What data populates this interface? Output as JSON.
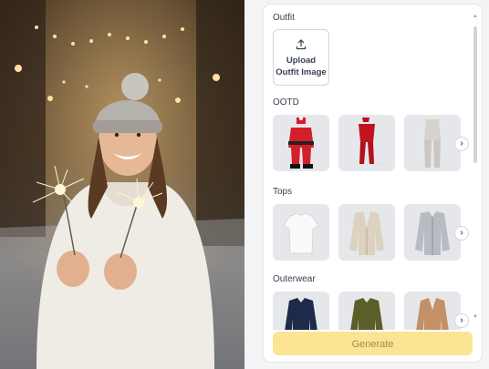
{
  "photo": {
    "icon": "woman-with-sparklers-photo"
  },
  "panel": {
    "outfit": {
      "title": "Outfit",
      "upload_line1": "Upload",
      "upload_line2": "Outfit Image",
      "upload_icon": "upload-icon"
    },
    "sections": [
      {
        "title": "OOTD",
        "items": [
          "santa-suit",
          "red-dress-outfit",
          "gray-lounge-set"
        ]
      },
      {
        "title": "Tops",
        "items": [
          "white-tshirt",
          "beige-cardigan",
          "gray-shirt"
        ]
      },
      {
        "title": "Outerwear",
        "items": [
          "navy-jacket",
          "olive-jacket",
          "camel-blazer"
        ]
      }
    ],
    "generate_label": "Generate",
    "colors": {
      "accent": "#fbe594",
      "accent_text": "#a08b4c",
      "panel_bg": "#ffffff",
      "page_bg": "#f3f4f6"
    }
  }
}
